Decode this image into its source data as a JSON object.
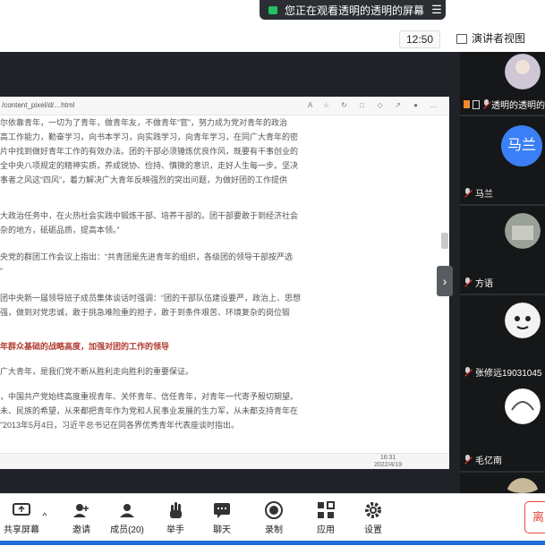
{
  "banner": {
    "text": "您正在观看透明的透明的屏幕",
    "menu": "☰"
  },
  "header": {
    "time": "12:50",
    "view_label": "演讲者视图"
  },
  "doc": {
    "url": "/content_pixel/d/…html",
    "lines": [
      "尔依靠青年，一切为了青年，做青年友，不做青年“官”，努力成为党对青年的政治",
      "高工作能力，勤奋学习，向书本学习，向实践学习，向青年学习，在同广大青年的密",
      "片中找到做好青年工作的有效办法。团的干部必须锤炼优良作风，既要有干事创业的",
      "全中央八项规定的精神实质，养成锐协、俭持、慎微的意识，走好人生每一步。坚决",
      "事者之风这“四风”，着力解决广大青年反映强烈的突出问题，为做好团的工作提供",
      "大政治任务中，在火热社会实践中锻炼干部、培养干部的。团干部要敢于到经济社会",
      "杂的地方，砥砺品质，提高本领。”",
      "央党的群团工作会议上指出：“共青团是先进青年的组织，各级团的领导干部按严选",
      "”",
      "团中央新一届领导班子成员集体谈话时强调：“团的干部队伍建设要严，政治上、思想",
      "强，做到对党忠诚，敢于挑急难险重的担子，敢于到条件艰苦、环境复杂的岗位锻",
      "年群众基础的战略高度，加强对团的工作的领导",
      "广大青年，是我们党不断从胜利走向胜利的重要保证。",
      "，中国共产党始终高度重视青年、关怀青年、信任青年，对青年一代寄予殷切期望。",
      "未、民族的希望，从来都把青年作为党和人民事业发展的生力军，从未都支持青年在",
      "”2013年5月4日，习近平总书记在同各界优秀青年代表座谈时指出。"
    ],
    "taskbar_time": "16:31",
    "taskbar_date": "2022/4/19"
  },
  "participants": [
    {
      "name": "透明的透明的",
      "type": "photo"
    },
    {
      "name": "马兰",
      "type": "initials",
      "initials": "马兰"
    },
    {
      "name": "方语",
      "type": "photo"
    },
    {
      "name": "张修远19031045",
      "type": "photo"
    },
    {
      "name": "毛亿南",
      "type": "photo"
    },
    {
      "name": "",
      "type": "photo"
    }
  ],
  "toolbar": {
    "share": "共享屏幕",
    "invite": "邀请",
    "members": "成员(20)",
    "raise_hand": "举手",
    "chat": "聊天",
    "record": "录制",
    "apps": "应用",
    "settings": "设置",
    "end": "离"
  },
  "colors": {
    "accent": "#1e6fd9",
    "end": "#e5483c",
    "dark_bg": "#1f2327"
  }
}
